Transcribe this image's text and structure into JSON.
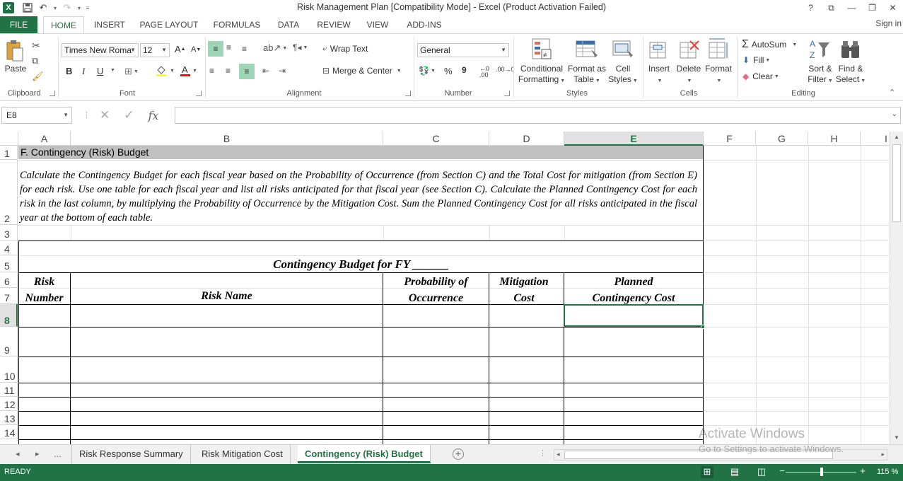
{
  "window": {
    "title": "Risk Management Plan  [Compatibility Mode] - Excel (Product Activation Failed)",
    "controls": [
      "?",
      "⧉",
      "—",
      "❐",
      "✕"
    ]
  },
  "ribbon": {
    "tabs": [
      "FILE",
      "HOME",
      "INSERT",
      "PAGE LAYOUT",
      "FORMULAS",
      "DATA",
      "REVIEW",
      "VIEW",
      "ADD-INS"
    ],
    "active_tab": "HOME",
    "sign_in": "Sign in",
    "clipboard": {
      "paste": "Paste",
      "label": "Clipboard"
    },
    "font": {
      "family": "Times New Roma",
      "size": "12",
      "bold": "B",
      "italic": "I",
      "underline": "U",
      "label": "Font"
    },
    "alignment": {
      "wrap_text": "Wrap Text",
      "merge_center": "Merge & Center",
      "label": "Alignment"
    },
    "number": {
      "format": "General",
      "percent": "%",
      "comma": "9",
      "label": "Number"
    },
    "styles": {
      "conditional_1": "Conditional",
      "conditional_2": "Formatting",
      "format_as_1": "Format as",
      "format_as_2": "Table",
      "cell_1": "Cell",
      "cell_2": "Styles",
      "label": "Styles"
    },
    "cells": {
      "insert": "Insert",
      "delete": "Delete",
      "format": "Format",
      "label": "Cells"
    },
    "editing": {
      "autosum": "AutoSum",
      "fill": "Fill",
      "clear": "Clear",
      "sort_1": "Sort &",
      "sort_2": "Filter",
      "find_1": "Find &",
      "find_2": "Select",
      "label": "Editing"
    }
  },
  "formula_bar": {
    "name_box": "E8",
    "fx": "fx",
    "value": ""
  },
  "sheet": {
    "columns": [
      "A",
      "B",
      "C",
      "D",
      "E",
      "F",
      "G",
      "H",
      "I"
    ],
    "selected_column": "E",
    "rows": [
      "1",
      "2",
      "3",
      "4",
      "5",
      "6",
      "7",
      "8",
      "9",
      "10",
      "11",
      "12",
      "13",
      "14"
    ],
    "selected_row": "8",
    "row1_title": "F. Contingency (Risk) Budget",
    "description": "Calculate the Contingency Budget for each fiscal year based on the Probability of Occurrence (from Section C) and the Total Cost for mitigation (from Section E) for each risk.  Use one table for each fiscal year and list all risks anticipated for that fiscal year (see Section C).  Calculate the Planned Contingency Cost for each risk in the last column, by multiplying the Probability of Occurrence by the Mitigation Cost.  Sum the Planned Contingency Cost for all risks anticipated in the fiscal year at the bottom of each table.",
    "table_title": "Contingency Budget for FY ______",
    "headers": {
      "risk_number_1": "Risk",
      "risk_number_2": "Number",
      "risk_name": "Risk Name",
      "probability_1": "Probability of",
      "probability_2": "Occurrence",
      "mitigation_1": "Mitigation",
      "mitigation_2": "Cost",
      "planned_1": "Planned",
      "planned_2": "Contingency Cost"
    }
  },
  "sheet_tabs": {
    "ellipsis": "...",
    "items": [
      "Risk Response Summary",
      "Risk Mitigation Cost",
      "Contingency (Risk) Budget"
    ],
    "active": "Contingency (Risk) Budget"
  },
  "watermark": {
    "title": "Activate Windows",
    "subtitle": "Go to Settings to activate Windows."
  },
  "status_bar": {
    "ready": "READY",
    "zoom": "115 %"
  },
  "colors": {
    "accent": "#217346",
    "header_band": "#c0c0c0",
    "gridline": "#e1e1e1"
  }
}
